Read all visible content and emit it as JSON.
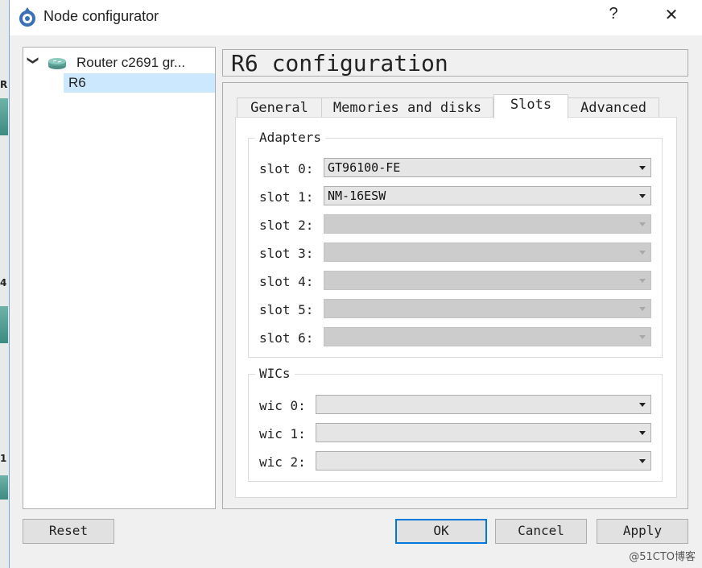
{
  "window": {
    "title": "Node configurator",
    "help_label": "?",
    "close_label": "✕"
  },
  "background": {
    "letters": [
      "R",
      "4",
      "1"
    ]
  },
  "tree": {
    "group_label": "Router c2691 gr...",
    "node_label": "R6",
    "expand_glyph": "❯"
  },
  "config": {
    "title": "R6 configuration",
    "tabs": [
      {
        "label": "General"
      },
      {
        "label": "Memories and disks"
      },
      {
        "label": "Slots"
      },
      {
        "label": "Advanced"
      }
    ],
    "active_tab": "Slots",
    "adapters": {
      "label": "Adapters",
      "slots": [
        {
          "label": "slot 0:",
          "value": "GT96100-FE",
          "enabled": true
        },
        {
          "label": "slot 1:",
          "value": "NM-16ESW",
          "enabled": true
        },
        {
          "label": "slot 2:",
          "value": "",
          "enabled": false
        },
        {
          "label": "slot 3:",
          "value": "",
          "enabled": false
        },
        {
          "label": "slot 4:",
          "value": "",
          "enabled": false
        },
        {
          "label": "slot 5:",
          "value": "",
          "enabled": false
        },
        {
          "label": "slot 6:",
          "value": "",
          "enabled": false
        }
      ]
    },
    "wics": {
      "label": "WICs",
      "slots": [
        {
          "label": "wic 0:",
          "value": ""
        },
        {
          "label": "wic 1:",
          "value": ""
        },
        {
          "label": "wic 2:",
          "value": ""
        }
      ]
    }
  },
  "buttons": {
    "reset": "Reset",
    "ok": "OK",
    "cancel": "Cancel",
    "apply": "Apply"
  },
  "watermark": "@51CTO博客",
  "colors": {
    "accent": "#0078d7",
    "selection": "#cce8ff"
  }
}
